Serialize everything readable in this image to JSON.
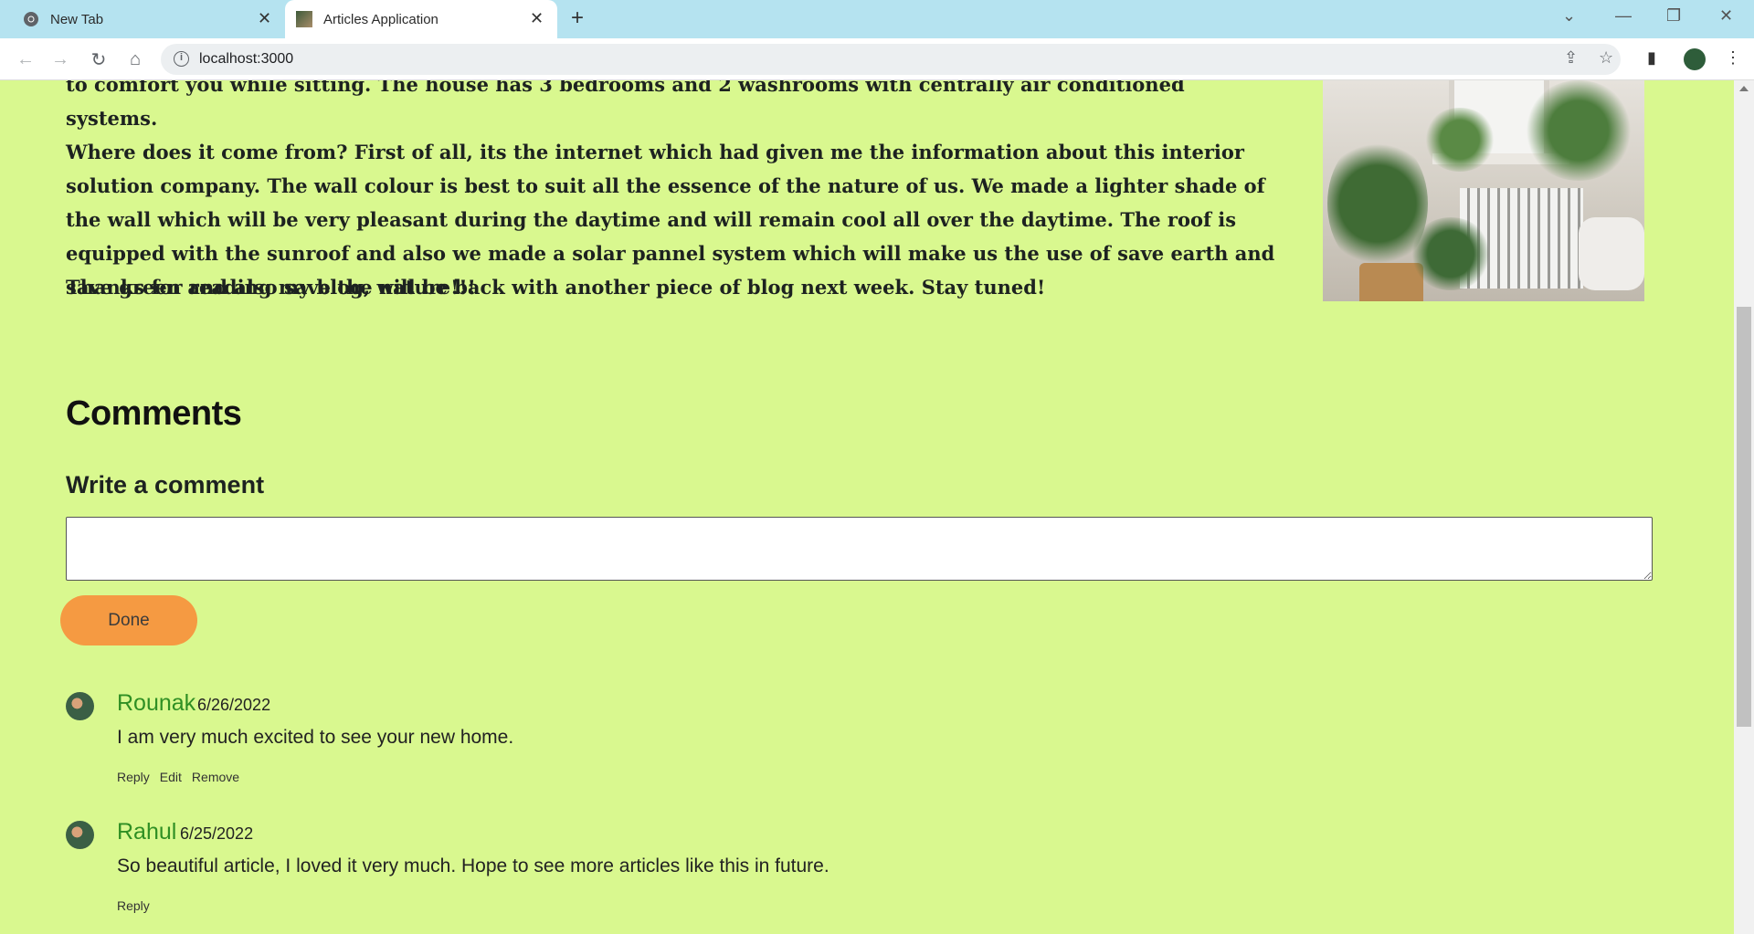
{
  "browser": {
    "tabs": [
      {
        "label": "New Tab",
        "icon": "chrome-icon"
      },
      {
        "label": "Articles Application",
        "icon": "site-favicon"
      }
    ],
    "url": "localhost:3000"
  },
  "article": {
    "paragraph_0": "to comfort you while sitting. The house has 3 bedrooms and 2 washrooms with centrally air conditioned systems.",
    "paragraph_1": "Where does it come from? First of all, its the internet which had given me the information about this interior solution company. The wall colour is best to suit all the essence of the nature of us. We made a lighter shade of the wall which will be very pleasant during the daytime and will remain cool all over the daytime. The roof is equipped with the sunroof and also we made a solar pannel system which will make us the use of save earth and save green and also save the nature!!!",
    "paragraph_2": "Thanks for reading my blog, will be back with another piece of blog next week. Stay tuned!"
  },
  "comments_section": {
    "title": "Comments",
    "write_label": "Write a comment",
    "textarea_value": "",
    "submit_label": "Done"
  },
  "comments": [
    {
      "author": "Rounak",
      "date": "6/26/2022",
      "text": "I am very much excited to see your new home.",
      "actions": [
        "Reply",
        "Edit",
        "Remove"
      ]
    },
    {
      "author": "Rahul",
      "date": "6/25/2022",
      "text": "So beautiful article, I loved it very much. Hope to see more articles like this in future.",
      "actions": [
        "Reply"
      ]
    }
  ],
  "colors": {
    "page_background": "#d9f88f",
    "author_name": "#2f8f24",
    "done_button": "#f59a42",
    "tab_strip": "#b5e3f0"
  }
}
